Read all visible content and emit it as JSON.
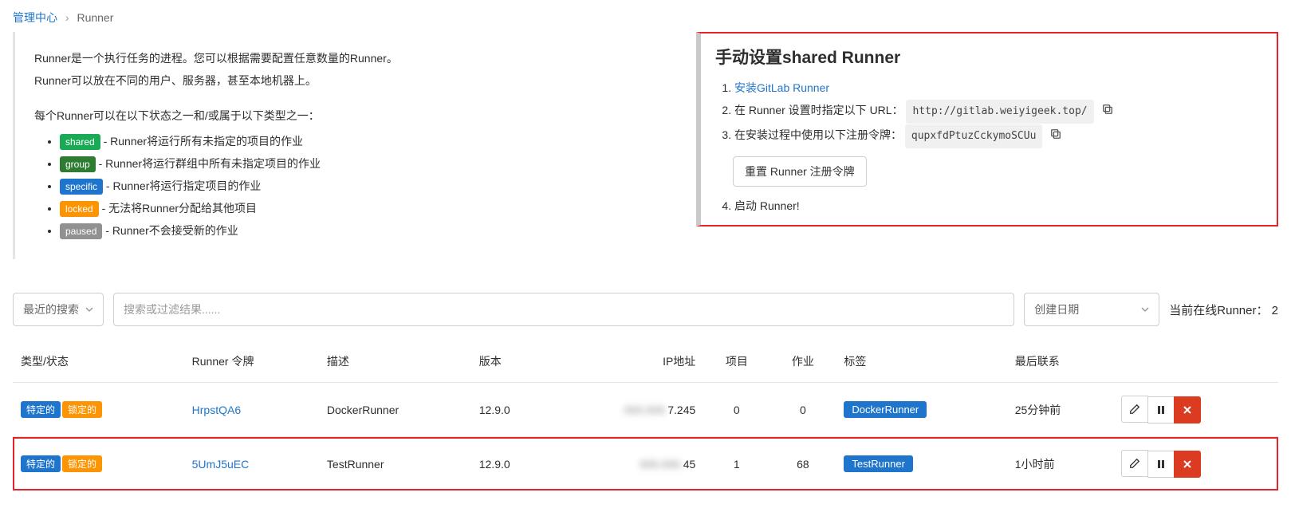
{
  "breadcrumb": {
    "root": "管理中心",
    "current": "Runner"
  },
  "intro": {
    "p1": "Runner是一个执行任务的进程。您可以根据需要配置任意数量的Runner。",
    "p2": "Runner可以放在不同的用户、服务器，甚至本地机器上。",
    "p3": "每个Runner可以在以下状态之一和/或属于以下类型之一：",
    "types": {
      "shared": {
        "label": "shared",
        "desc": "- Runner将运行所有未指定的项目的作业"
      },
      "group": {
        "label": "group",
        "desc": "- Runner将运行群组中所有未指定项目的作业"
      },
      "specific": {
        "label": "specific",
        "desc": "- Runner将运行指定项目的作业"
      },
      "locked": {
        "label": "locked",
        "desc": "- 无法将Runner分配给其他项目"
      },
      "paused": {
        "label": "paused",
        "desc": "- Runner不会接受新的作业"
      }
    }
  },
  "setup": {
    "title": "手动设置shared Runner",
    "step1_link": "安装GitLab Runner",
    "step2_text": "在 Runner 设置时指定以下 URL：",
    "step2_url": "http://gitlab.weiyigeek.top/",
    "step3_text": "在安装过程中使用以下注册令牌：",
    "step3_token": "qupxfdPtuzCckymoSCUu",
    "reset_btn": "重置 Runner 注册令牌",
    "step4_text": "启动 Runner!"
  },
  "filter": {
    "recent": "最近的搜索",
    "placeholder": "搜索或过滤结果......",
    "sort": "创建日期",
    "online_label": "当前在线Runner：",
    "online_count": "2"
  },
  "columns": {
    "type": "类型/状态",
    "token": "Runner 令牌",
    "desc": "描述",
    "version": "版本",
    "ip": "IP地址",
    "projects": "项目",
    "jobs": "作业",
    "tags": "标签",
    "last": "最后联系"
  },
  "status_labels": {
    "specific": "特定的",
    "locked": "锁定的"
  },
  "rows": [
    {
      "token": "HrpstQA6",
      "desc": "DockerRunner",
      "version": "12.9.0",
      "ip_suffix": "7.245",
      "projects": "0",
      "jobs": "0",
      "tag": "DockerRunner",
      "last": "25分钟前",
      "highlight": false
    },
    {
      "token": "5UmJ5uEC",
      "desc": "TestRunner",
      "version": "12.9.0",
      "ip_suffix": "45",
      "projects": "1",
      "jobs": "68",
      "tag": "TestRunner",
      "last": "1小时前",
      "highlight": true
    }
  ]
}
